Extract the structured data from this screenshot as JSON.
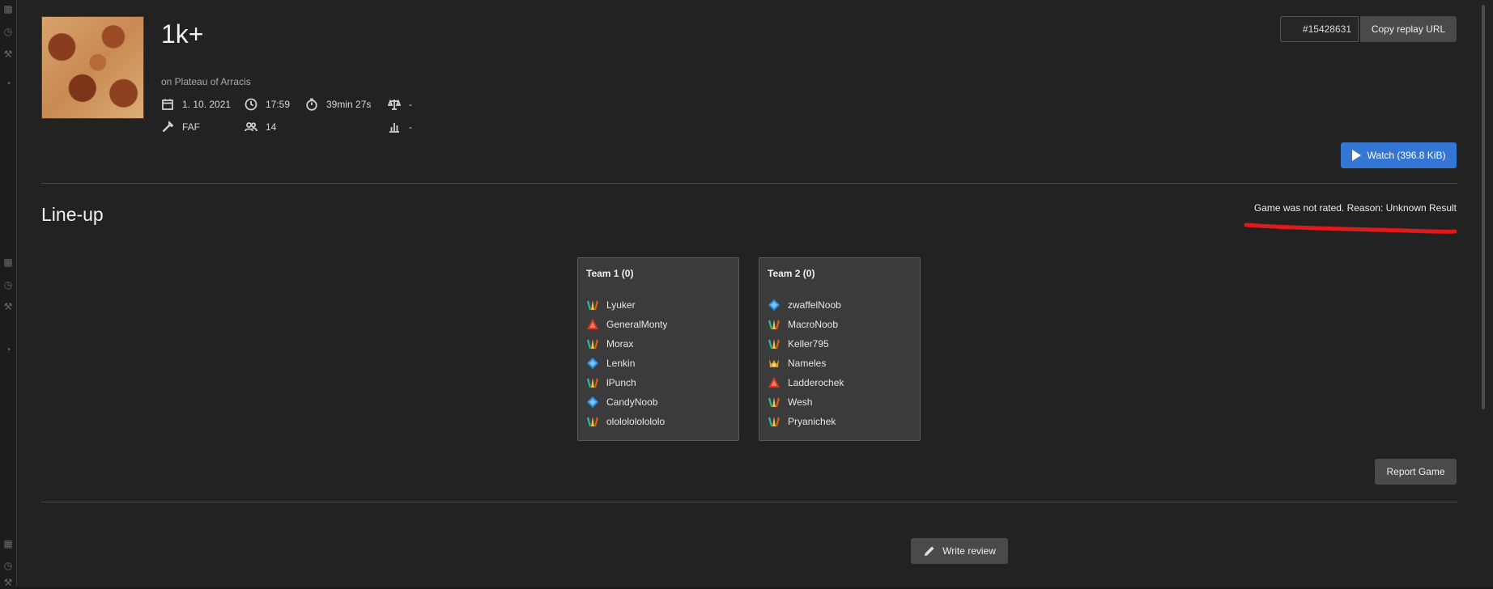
{
  "game": {
    "title": "1k+",
    "map_line": "on Plateau of Arracis",
    "date": "1. 10. 2021",
    "time": "17:59",
    "duration": "39min 27s",
    "balance": "-",
    "mod": "FAF",
    "players": "14",
    "rating": "-"
  },
  "header": {
    "replay_id": "#15428631",
    "copy_label": "Copy replay URL",
    "watch_label": "Watch (396.8 KiB)"
  },
  "lineup": {
    "title": "Line-up",
    "rating_notice": "Game was not rated. Reason: Unknown Result",
    "teams": [
      {
        "title": "Team 1 (0)",
        "players": [
          {
            "name": "Lyuker",
            "faction": "seraphim"
          },
          {
            "name": "GeneralMonty",
            "faction": "cybran"
          },
          {
            "name": "Morax",
            "faction": "seraphim"
          },
          {
            "name": "Lenkin",
            "faction": "uef"
          },
          {
            "name": "lPunch",
            "faction": "seraphim"
          },
          {
            "name": "CandyNoob",
            "faction": "uef"
          },
          {
            "name": "olololololololo",
            "faction": "seraphim"
          }
        ]
      },
      {
        "title": "Team 2 (0)",
        "players": [
          {
            "name": "zwaffelNoob",
            "faction": "uef"
          },
          {
            "name": "MacroNoob",
            "faction": "seraphim"
          },
          {
            "name": "Keller795",
            "faction": "seraphim"
          },
          {
            "name": "Nameles",
            "faction": "aeon"
          },
          {
            "name": "Ladderochek",
            "faction": "cybran"
          },
          {
            "name": "Wesh",
            "faction": "seraphim"
          },
          {
            "name": "Pryanichek",
            "faction": "seraphim"
          }
        ]
      }
    ]
  },
  "actions": {
    "report_label": "Report Game",
    "review_label": "Write review"
  },
  "colors": {
    "background": "#222222",
    "accent": "#3576d4",
    "annotation": "#e01919"
  }
}
